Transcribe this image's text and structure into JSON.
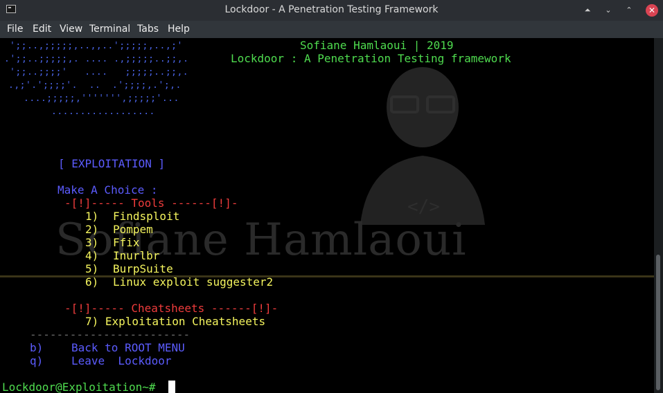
{
  "window": {
    "title": "Lockdoor - A Penetration Testing Framework",
    "buttons": {
      "keep_above": "⏶",
      "minimize": "⌄",
      "maximize": "⌃",
      "close": "✕"
    }
  },
  "menubar": [
    "File",
    "Edit",
    "View",
    "Terminal",
    "Tabs",
    "Help"
  ],
  "banner": {
    "author": "Sofiane Hamlaoui | 2019",
    "subtitle": "Lockdoor : A Penetration Testing framework",
    "ascii": [
      "';;..,;;;;;,..,,..';;;;;,..,;'",
      ".';;..;;;;;,. .... .,;;;;;..;;,.",
      "';;..;;;;'   ....   ;;;;;..;;,.",
      ".,;'.';;;;'.  ..  .';;;;,.';,.",
      "....;;;;;,''''''',;;;;;'...",
      ".................."
    ]
  },
  "section_title": "[ EXPLOITATION ]",
  "prompt_heading": "Make A Choice :",
  "tools_header": "-[!]----- Tools ------[!]-",
  "tools": [
    {
      "num": "1)",
      "name": "Findsploit"
    },
    {
      "num": "2)",
      "name": "Pompem"
    },
    {
      "num": "3)",
      "name": "Ffix"
    },
    {
      "num": "4)",
      "name": "Inurlbr"
    },
    {
      "num": "5)",
      "name": "BurpSuite"
    },
    {
      "num": "6)",
      "name": "Linux exploit suggester2"
    }
  ],
  "cheats_header": "-[!]----- Cheatsheets ------[!]-",
  "cheatsheet_item": "7) Exploitation Cheatsheets",
  "separator": "------------------------",
  "nav": [
    {
      "key": "b)",
      "label": "Back to ROOT MENU"
    },
    {
      "key": "q)",
      "label": "Leave  Lockdoor"
    }
  ],
  "shell_prompt": "Lockdoor@Exploitation~# ",
  "watermark": "Sofiane Hamlaoui",
  "colors": {
    "blue": "#5c5cff",
    "green": "#4fdc4f",
    "red": "#ef3c3c",
    "yellow": "#f5f55e"
  }
}
